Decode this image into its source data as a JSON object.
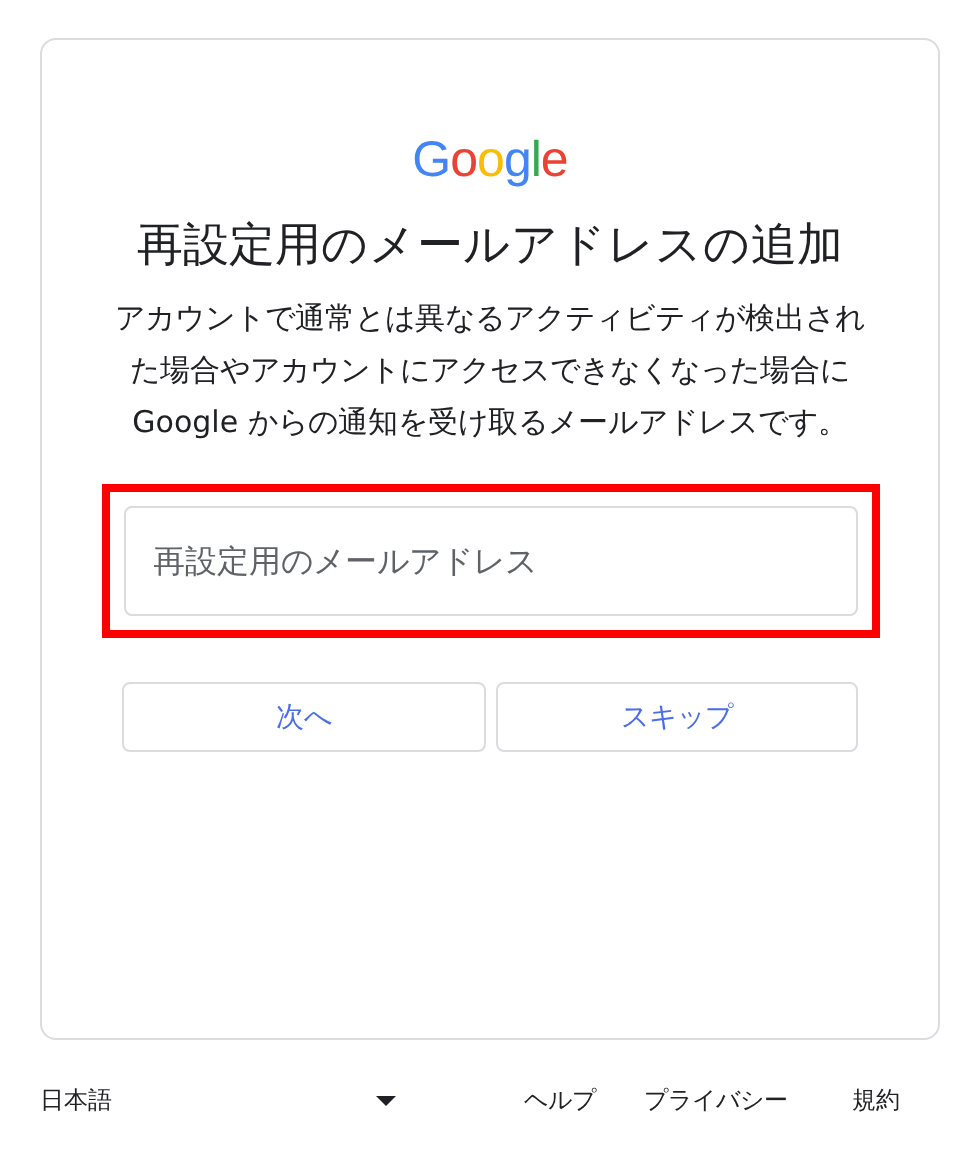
{
  "logo": {
    "text": "Google"
  },
  "title": "再設定用のメールアドレスの追加",
  "description": "アカウントで通常とは異なるアクティビティが検出された場合やアカウントにアクセスできなくなった場合に Google からの通知を受け取るメールアドレスです。",
  "email_field": {
    "placeholder": "再設定用のメールアドレス",
    "highlighted": true
  },
  "buttons": [
    {
      "label": "次へ"
    },
    {
      "label": "スキップ"
    }
  ],
  "footer": {
    "language": "日本語",
    "links": [
      "ヘルプ",
      "プライバシー",
      "規約"
    ]
  }
}
